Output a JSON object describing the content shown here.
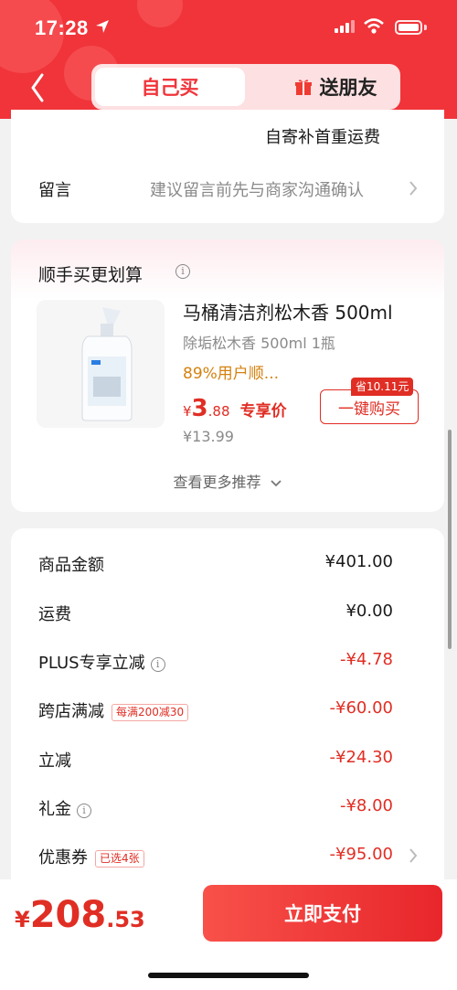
{
  "status_bar": {
    "time": "17:28"
  },
  "header": {
    "tab_self": "自己买",
    "tab_gift": "送朋友"
  },
  "shipping_note": "自寄补首重运费",
  "message_row": {
    "label": "留言",
    "placeholder": "建议留言前先与商家沟通确认"
  },
  "recommend": {
    "title": "顺手买更划算",
    "product_name": "马桶清洁剂松木香 500ml",
    "spec": "除垢松木香 500ml 1瓶",
    "rating": "89%用户顺...",
    "price_symbol": "¥",
    "price_int": "3",
    "price_dec": ".88",
    "price_tag": "专享价",
    "original_price": "¥13.99",
    "save_badge": "省10.11元",
    "buy_button": "一键购买",
    "more": "查看更多推荐"
  },
  "summary": {
    "rows": [
      {
        "label": "商品金额",
        "value": "¥401.00"
      },
      {
        "label": "运费",
        "value": "¥0.00"
      },
      {
        "label": "PLUS专享立减",
        "value": "-¥4.78"
      },
      {
        "label": "跨店满减",
        "badge": "每满200减30",
        "value": "-¥60.00"
      },
      {
        "label": "立减",
        "value": "-¥24.30"
      },
      {
        "label": "礼金",
        "value": "-¥8.00"
      },
      {
        "label": "优惠券",
        "badge": "已选4张",
        "value": "-¥95.00"
      }
    ]
  },
  "total": {
    "symbol": "¥",
    "int": "208",
    "dec": ".53"
  },
  "pay_button": "立即支付",
  "colors": {
    "brand_red": "#f0343a",
    "price_red": "#e02e24",
    "orange": "#d4810f"
  }
}
